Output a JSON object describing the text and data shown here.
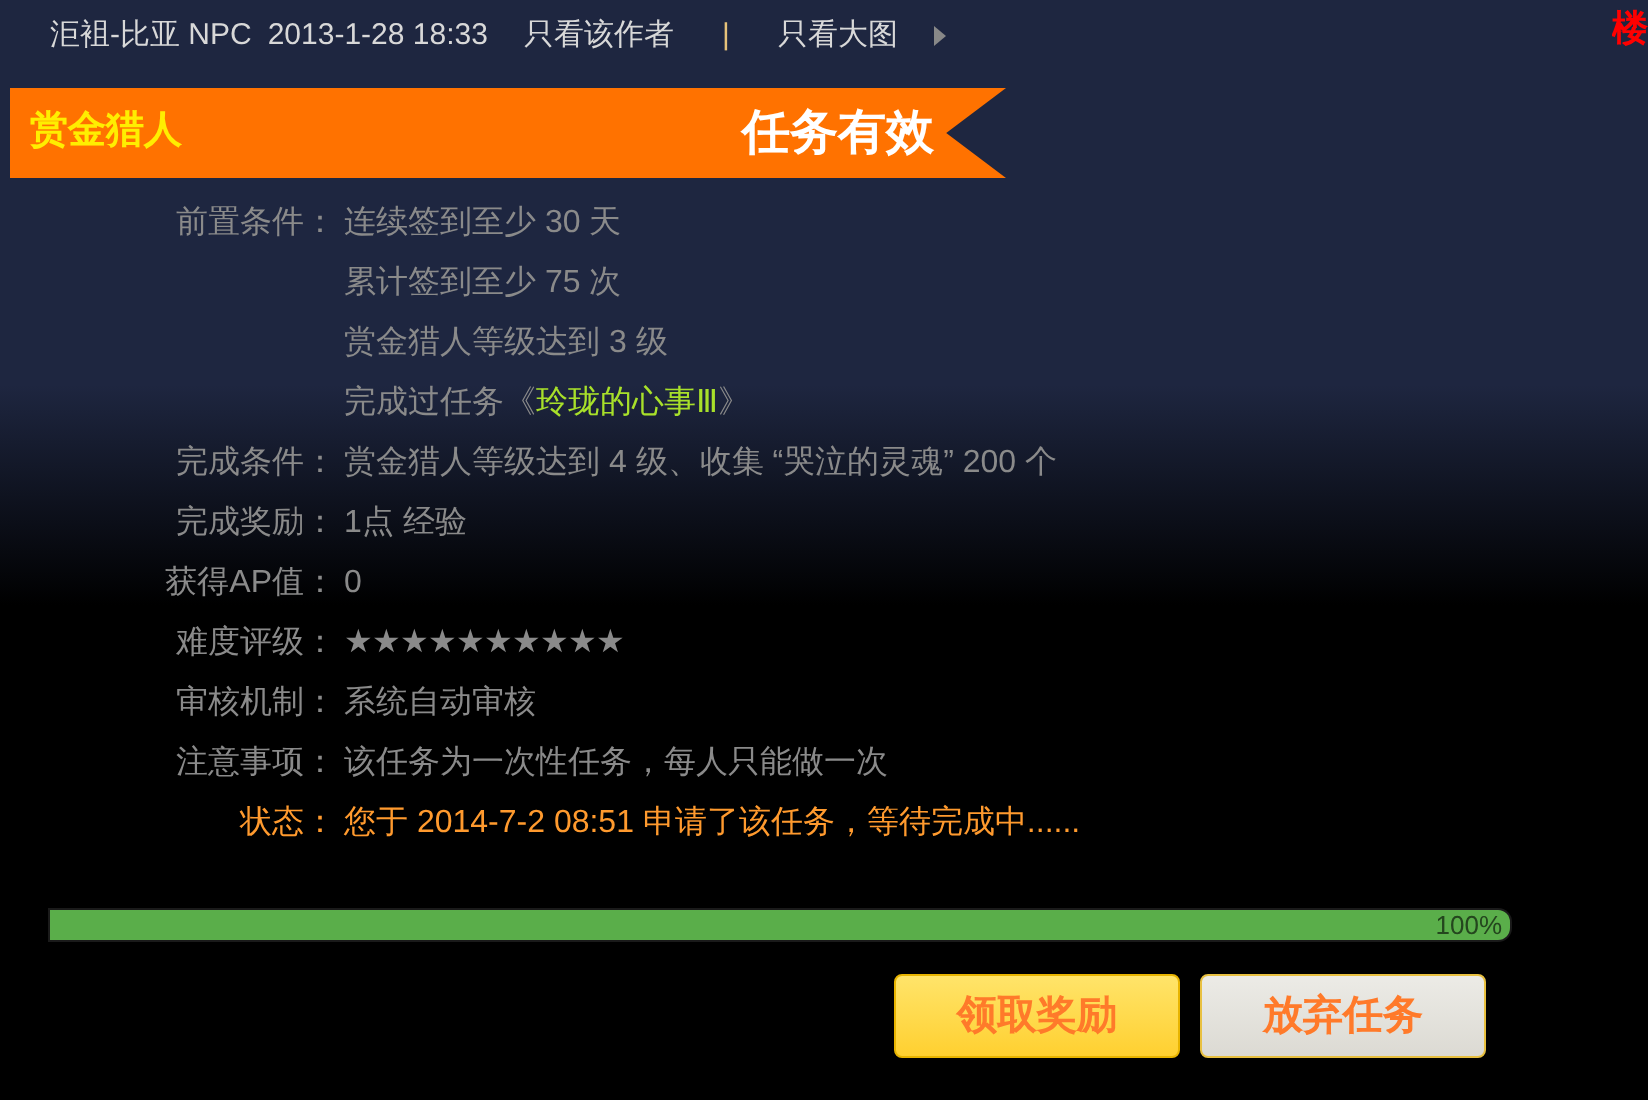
{
  "header": {
    "author": "洰袓-比亚 NPC",
    "time": "2013-1-28 18:33",
    "links": [
      "只看该作者",
      "只看大图"
    ],
    "separator": "|",
    "floor": "楼"
  },
  "banner": {
    "category": "赏金猎人",
    "status": "任务有效"
  },
  "prerequisites": {
    "label": "前置条件：",
    "items": [
      {
        "kind": "text",
        "text": "连续签到至少 30 天"
      },
      {
        "kind": "text",
        "text": "累计签到至少 75 次"
      },
      {
        "kind": "text",
        "text": "赏金猎人等级达到 3 级"
      },
      {
        "kind": "link",
        "prefix": "完成过任务《",
        "link": "玲珑的心事Ⅲ",
        "suffix": "》"
      }
    ]
  },
  "fields": [
    {
      "kind": "text",
      "label": "完成条件：",
      "value": "赏金猎人等级达到 4 级、收集 “哭泣的灵魂” 200 个"
    },
    {
      "kind": "text",
      "label": "完成奖励：",
      "value": "1点 经验"
    },
    {
      "kind": "text",
      "label": "获得AP值：",
      "value": "0"
    },
    {
      "kind": "stars",
      "label": "难度评级：",
      "stars": 10
    },
    {
      "kind": "text",
      "label": "审核机制：",
      "value": "系统自动审核"
    },
    {
      "kind": "text",
      "label": "注意事项：",
      "value": "该任务为一次性任务，每人只能做一次"
    },
    {
      "kind": "status",
      "label": "状态：",
      "value": "您于 2014-7-2 08:51 申请了该任务，等待完成中......"
    }
  ],
  "progress": {
    "level": 1,
    "reading": "100%"
  },
  "buttons": [
    {
      "kind": "primary",
      "label": "领取奖励"
    },
    {
      "kind": "secondary",
      "label": "放弃任务"
    }
  ]
}
